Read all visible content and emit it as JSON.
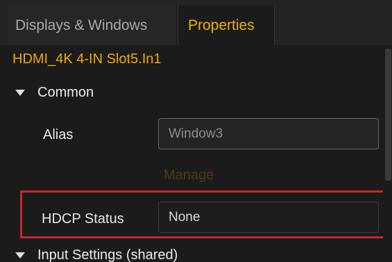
{
  "tabs": {
    "displays_windows": "Displays & Windows",
    "properties": "Properties"
  },
  "object_title": "HDMI_4K 4-IN Slot5.In1",
  "sections": {
    "common": "Common",
    "input_settings": "Input Settings (shared)"
  },
  "properties": {
    "alias": {
      "label": "Alias",
      "value": "Window3"
    },
    "manage_label": "Manage",
    "hdcp_status": {
      "label": "HDCP Status",
      "value": "None"
    }
  },
  "colors": {
    "accent": "#f0b000",
    "highlight": "#c4282f",
    "background": "#1b1b1b"
  },
  "icons": {
    "section_toggle": "caret-down-icon"
  }
}
